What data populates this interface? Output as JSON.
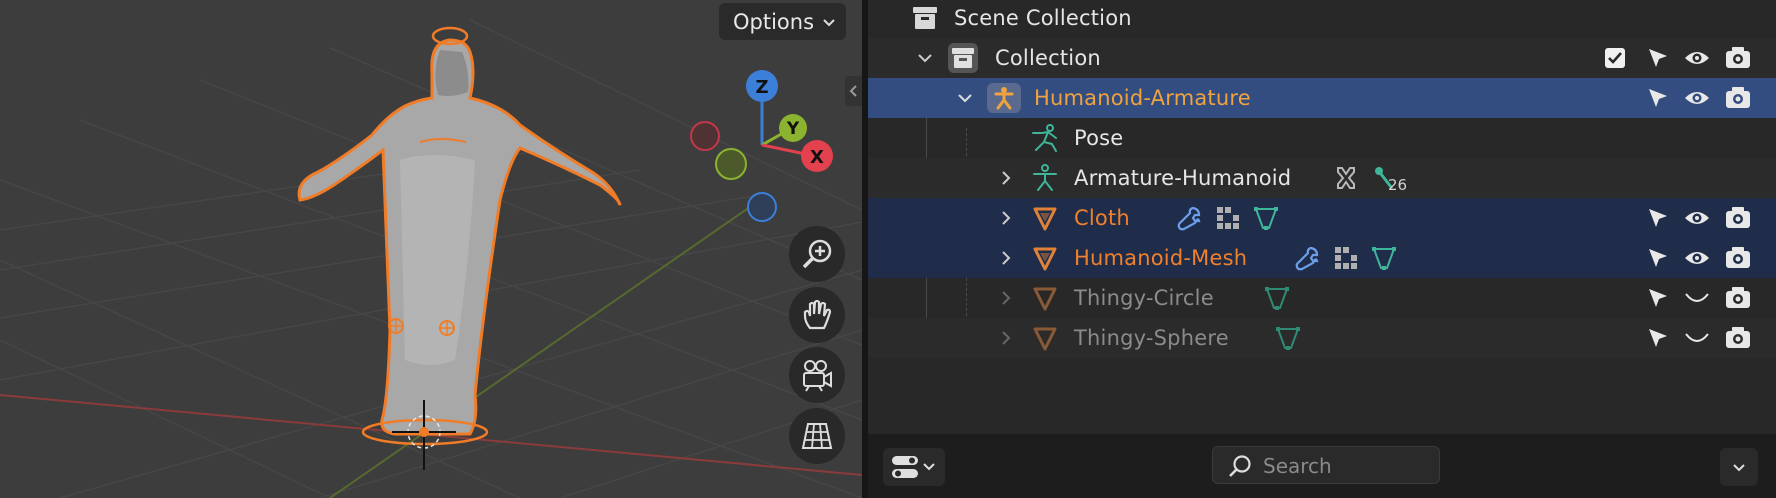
{
  "viewport": {
    "options_label": "Options",
    "gizmo": {
      "z_label": "Z",
      "y_label": "Y",
      "x_label": "X"
    },
    "nav_buttons": [
      "zoom-icon",
      "hand-pan-icon",
      "camera-icon",
      "grid-ortho-icon"
    ]
  },
  "outliner": {
    "rows": [
      {
        "label": "Scene Collection",
        "icon": "scene-collection-icon",
        "state": "normal"
      },
      {
        "label": "Collection",
        "icon": "collection-icon",
        "state": "normal"
      },
      {
        "label": "Humanoid-Armature",
        "icon": "armature-icon",
        "state": "active",
        "color": "#f0a23f"
      },
      {
        "label": "Pose",
        "icon": "pose-icon",
        "state": "normal"
      },
      {
        "label": "Armature-Humanoid",
        "icon": "armature-data-icon",
        "state": "normal",
        "bone_count": "26"
      },
      {
        "label": "Cloth",
        "icon": "mesh-icon",
        "state": "selected",
        "color": "#f0802b"
      },
      {
        "label": "Humanoid-Mesh",
        "icon": "mesh-icon",
        "state": "selected",
        "color": "#f0802b"
      },
      {
        "label": "Thingy-Circle",
        "icon": "mesh-icon",
        "state": "disabled",
        "color": "#8b8b8b"
      },
      {
        "label": "Thingy-Sphere",
        "icon": "mesh-icon",
        "state": "disabled",
        "color": "#8b8b8b"
      }
    ]
  },
  "footer": {
    "search_placeholder": "Search"
  },
  "colors": {
    "active_row": "#334d80",
    "selected_row": "#1f2d4b",
    "selection_outline": "#f07c28",
    "gizmo_x": "#e2414d",
    "gizmo_y": "#8cb32f",
    "gizmo_z": "#3c7fd9"
  }
}
